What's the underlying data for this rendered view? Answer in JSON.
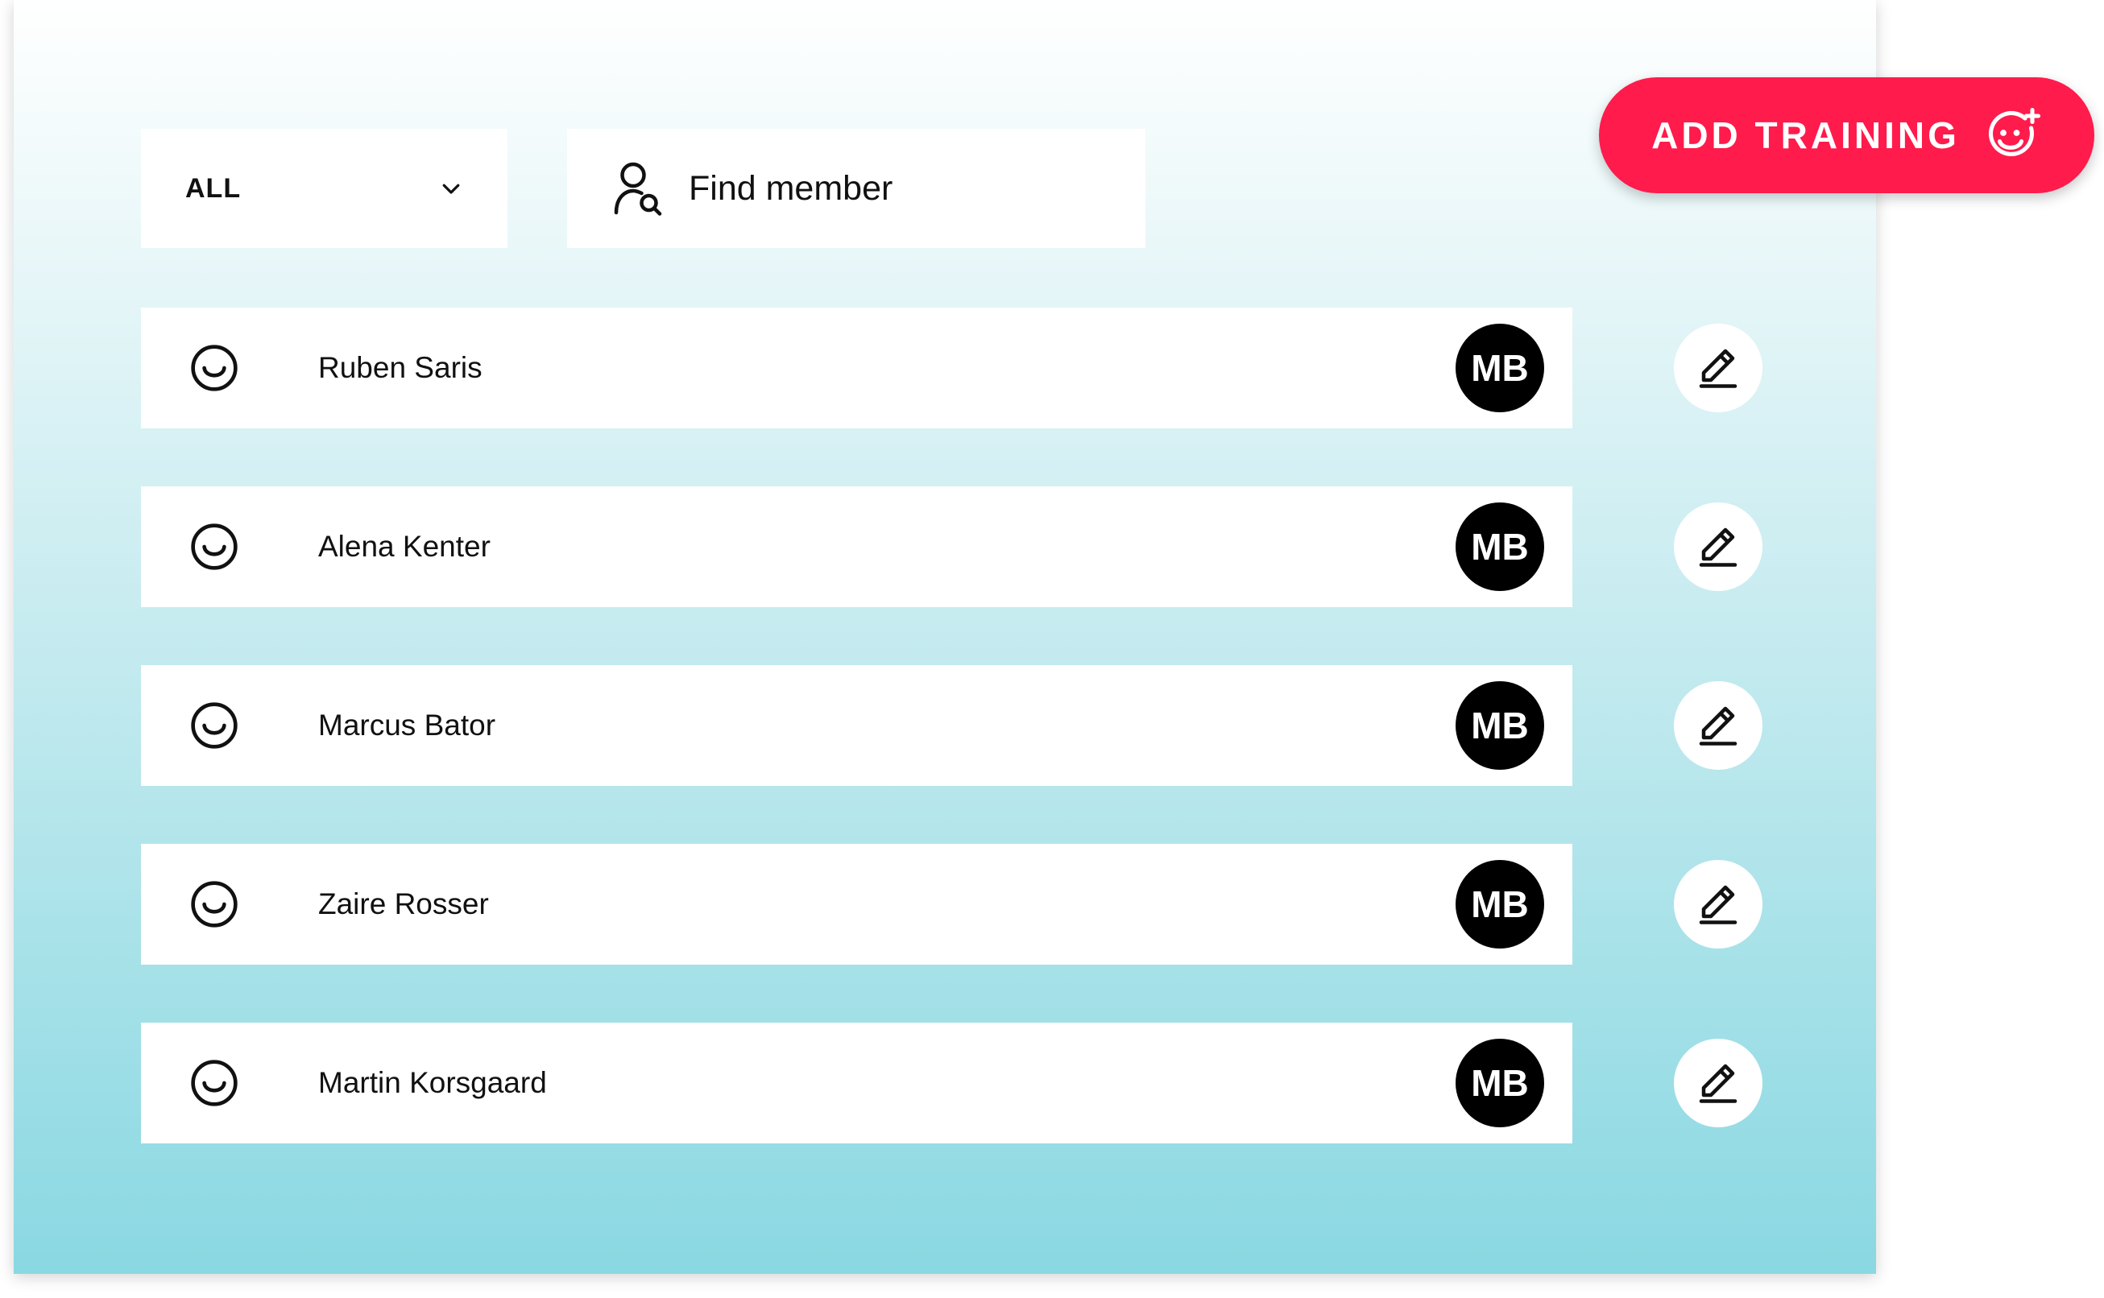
{
  "filter": {
    "selected": "ALL",
    "icon": "chevron-down-icon"
  },
  "search": {
    "placeholder": "Find member",
    "icon": "find-member-icon"
  },
  "add_training": {
    "label": "ADD TRAINING",
    "icon": "smile-plus-icon",
    "color": "#ff1b4c"
  },
  "members": [
    {
      "name": "Ruben Saris",
      "initials": "MB"
    },
    {
      "name": "Alena Kenter",
      "initials": "MB"
    },
    {
      "name": "Marcus Bator",
      "initials": "MB"
    },
    {
      "name": "Zaire Rosser",
      "initials": "MB"
    },
    {
      "name": "Martin Korsgaard",
      "initials": "MB"
    }
  ],
  "row_icons": {
    "status": "smile-icon",
    "edit": "pencil-icon"
  }
}
